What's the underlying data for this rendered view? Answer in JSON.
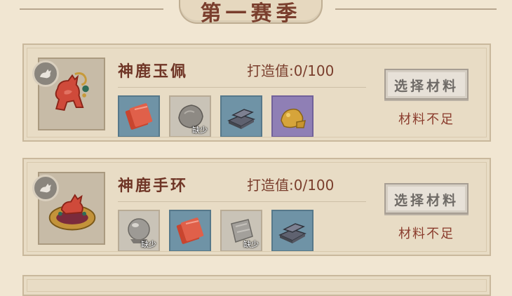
{
  "header": {
    "title": "第一赛季"
  },
  "items": [
    {
      "name": "神鹿玉佩",
      "forge_value": "打造值:0/100",
      "portrait_icon": "deer-jade-pendant-icon",
      "select_button": "选择材料",
      "status": "材料不足",
      "materials": [
        {
          "icon": "red-cloth-bolt-icon",
          "rarity": "blue",
          "lack": ""
        },
        {
          "icon": "gray-rock-icon",
          "rarity": "gray",
          "lack": "缺少"
        },
        {
          "icon": "iron-ingot-icon",
          "rarity": "blue",
          "lack": ""
        },
        {
          "icon": "gold-ore-icon",
          "rarity": "purple",
          "lack": ""
        }
      ]
    },
    {
      "name": "神鹿手环",
      "forge_value": "打造值:0/100",
      "portrait_icon": "deer-bracelet-icon",
      "select_button": "选择材料",
      "status": "材料不足",
      "materials": [
        {
          "icon": "crystal-ball-icon",
          "rarity": "gray",
          "lack": "缺少"
        },
        {
          "icon": "red-cloth-bolt-icon",
          "rarity": "blue",
          "lack": ""
        },
        {
          "icon": "gray-cloth-icon",
          "rarity": "gray",
          "lack": "缺少"
        },
        {
          "icon": "iron-ingot-icon",
          "rarity": "blue",
          "lack": ""
        }
      ]
    }
  ],
  "colors": {
    "background": "#f1e6d2",
    "title": "#7a3e2d",
    "rarity_gray": "#c9c3b7",
    "rarity_blue": "#6f93a6",
    "rarity_purple": "#8f7fb5"
  }
}
